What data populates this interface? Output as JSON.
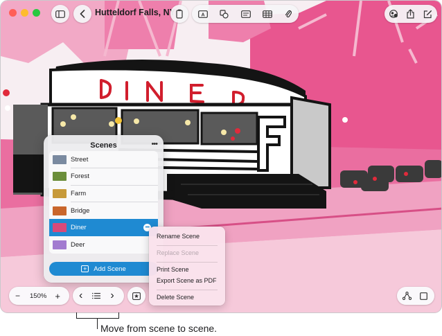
{
  "window": {
    "title": "Hutteldorf Falls, NY",
    "traffic_lights": {
      "close": "#ff5f57",
      "minimize": "#febc2e",
      "zoom": "#28c840"
    }
  },
  "toolbar": {
    "icons": [
      "sidebar-icon",
      "back-chevron-icon",
      "phone-icon",
      "textbox-icon",
      "shapes-icon",
      "media-icon",
      "table-icon",
      "attachment-icon",
      "collaborate-icon",
      "share-icon",
      "compose-icon"
    ]
  },
  "canvas": {
    "sign_text": "DINER",
    "accent_pink": "#e94f8f",
    "ink": "#141414"
  },
  "scenes_popover": {
    "title": "Scenes",
    "more_label": "•••",
    "items": [
      {
        "label": "Street",
        "thumb": "#7a8aa0",
        "selected": false
      },
      {
        "label": "Forest",
        "thumb": "#6b8e3a",
        "selected": false
      },
      {
        "label": "Farm",
        "thumb": "#c79a3a",
        "selected": false
      },
      {
        "label": "Bridge",
        "thumb": "#c9662b",
        "selected": false
      },
      {
        "label": "Diner",
        "thumb": "#d84a7a",
        "selected": true
      },
      {
        "label": "Deer",
        "thumb": "#a27bd0",
        "selected": false
      }
    ],
    "add_button": "Add Scene",
    "selection_color": "#1f8ad2"
  },
  "context_menu": {
    "items": [
      {
        "label": "Rename Scene",
        "enabled": true
      },
      {
        "label": "Replace Scene",
        "enabled": false
      },
      {
        "label": "Print Scene",
        "enabled": true
      },
      {
        "label": "Export Scene as PDF",
        "enabled": true
      },
      {
        "label": "Delete Scene",
        "enabled": true
      }
    ]
  },
  "bottom_toolbar": {
    "zoom_out": "−",
    "zoom_level": "150%",
    "zoom_in": "+",
    "prev": "‹",
    "next": "›"
  },
  "caption": "Move from scene to scene."
}
